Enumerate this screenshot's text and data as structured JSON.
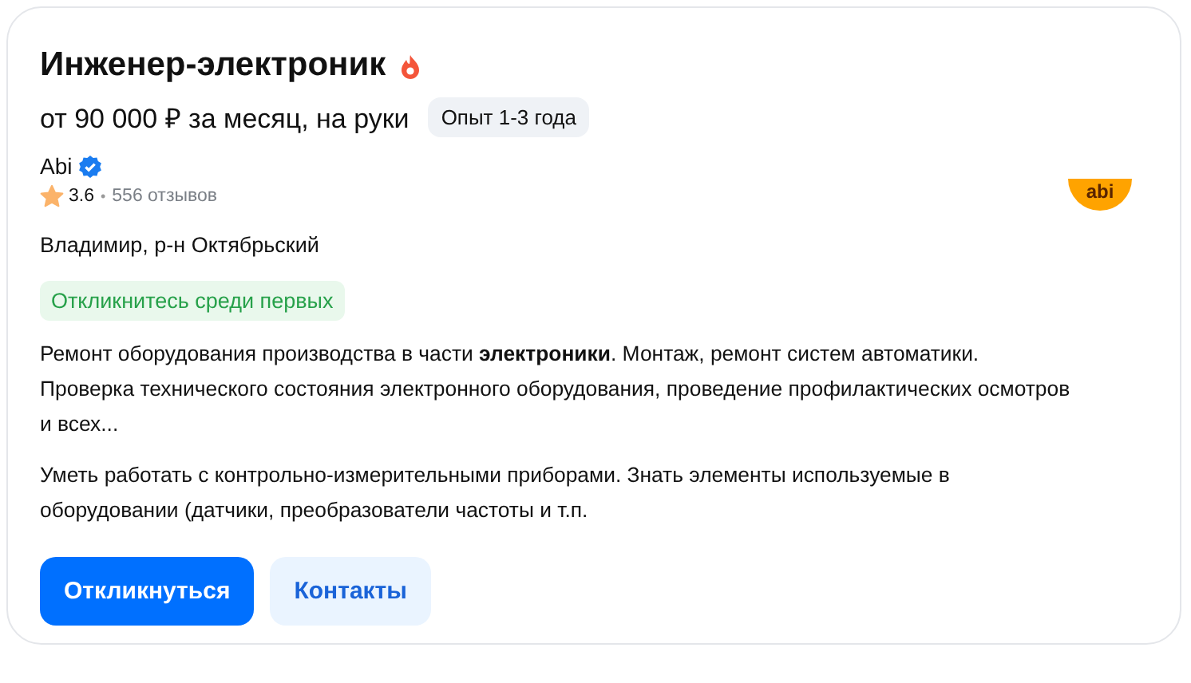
{
  "vacancy": {
    "title": "Инженер-электроник",
    "hot": true,
    "salary": "от 90 000 ₽ за месяц, на руки",
    "experience": "Опыт 1-3 года"
  },
  "company": {
    "name": "Abi",
    "verified": true,
    "rating": "3.6",
    "separator": "•",
    "reviews": "556 отзывов",
    "logo_text": "abi"
  },
  "location": "Владимир, р-н Октябрьский",
  "badge": "Откликнитесь среди первых",
  "description": [
    "Ремонт оборудования производства в части **электроники**. Монтаж, ремонт систем автоматики. Проверка технического состояния электронного оборудования, проведение профилактических осмотров и всех...",
    "Уметь работать с контрольно-измерительными приборами. Знать элементы используемые в оборудовании (датчики, преобразователи частоты и т.п."
  ],
  "buttons": [
    {
      "label": "Откликнуться",
      "kind": "primary"
    },
    {
      "label": "Контакты",
      "kind": "secondary"
    }
  ]
}
